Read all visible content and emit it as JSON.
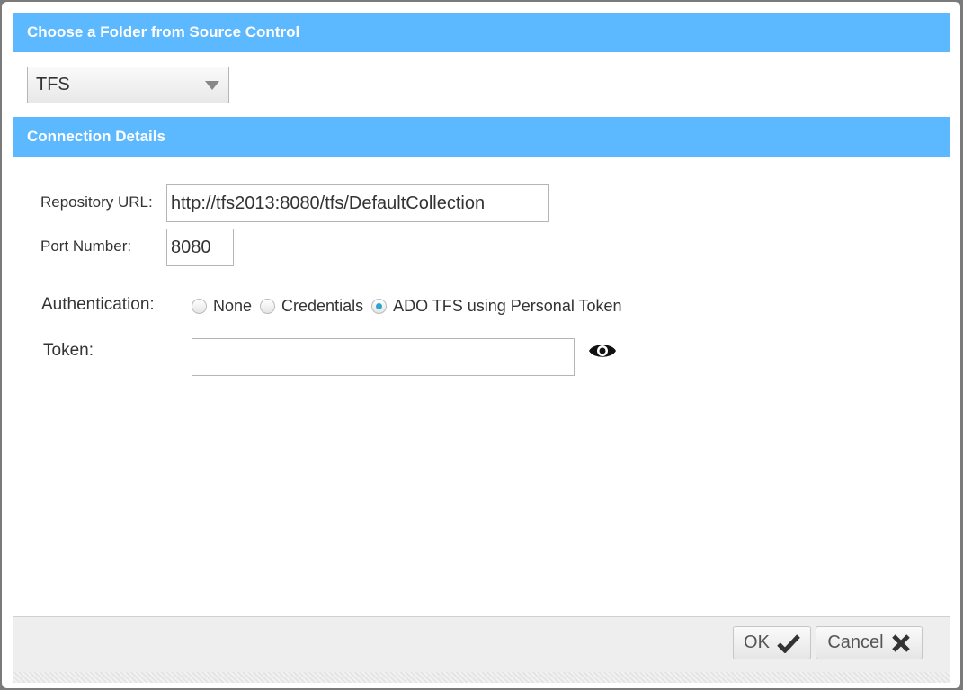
{
  "dialog": {
    "section1_title": "Choose a Folder from Source Control",
    "source_select": {
      "value": "TFS"
    },
    "section2_title": "Connection Details"
  },
  "connection": {
    "repo_url_label": "Repository URL:",
    "repo_url_value": "http://tfs2013:8080/tfs/DefaultCollection",
    "port_label": "Port Number:",
    "port_value": "8080",
    "auth_label": "Authentication:",
    "auth_options": [
      {
        "label": "None",
        "checked": false
      },
      {
        "label": "Credentials",
        "checked": false
      },
      {
        "label": "ADO TFS using Personal Token",
        "checked": true
      }
    ],
    "token_label": "Token:",
    "token_value": ""
  },
  "footer": {
    "ok_label": "OK",
    "cancel_label": "Cancel"
  },
  "colors": {
    "header_bg": "#5cb8ff",
    "radio_checked": "#2aa6cf"
  },
  "icons": [
    "caret-down-icon",
    "eye-icon",
    "checkmark-icon",
    "close-x-icon"
  ]
}
